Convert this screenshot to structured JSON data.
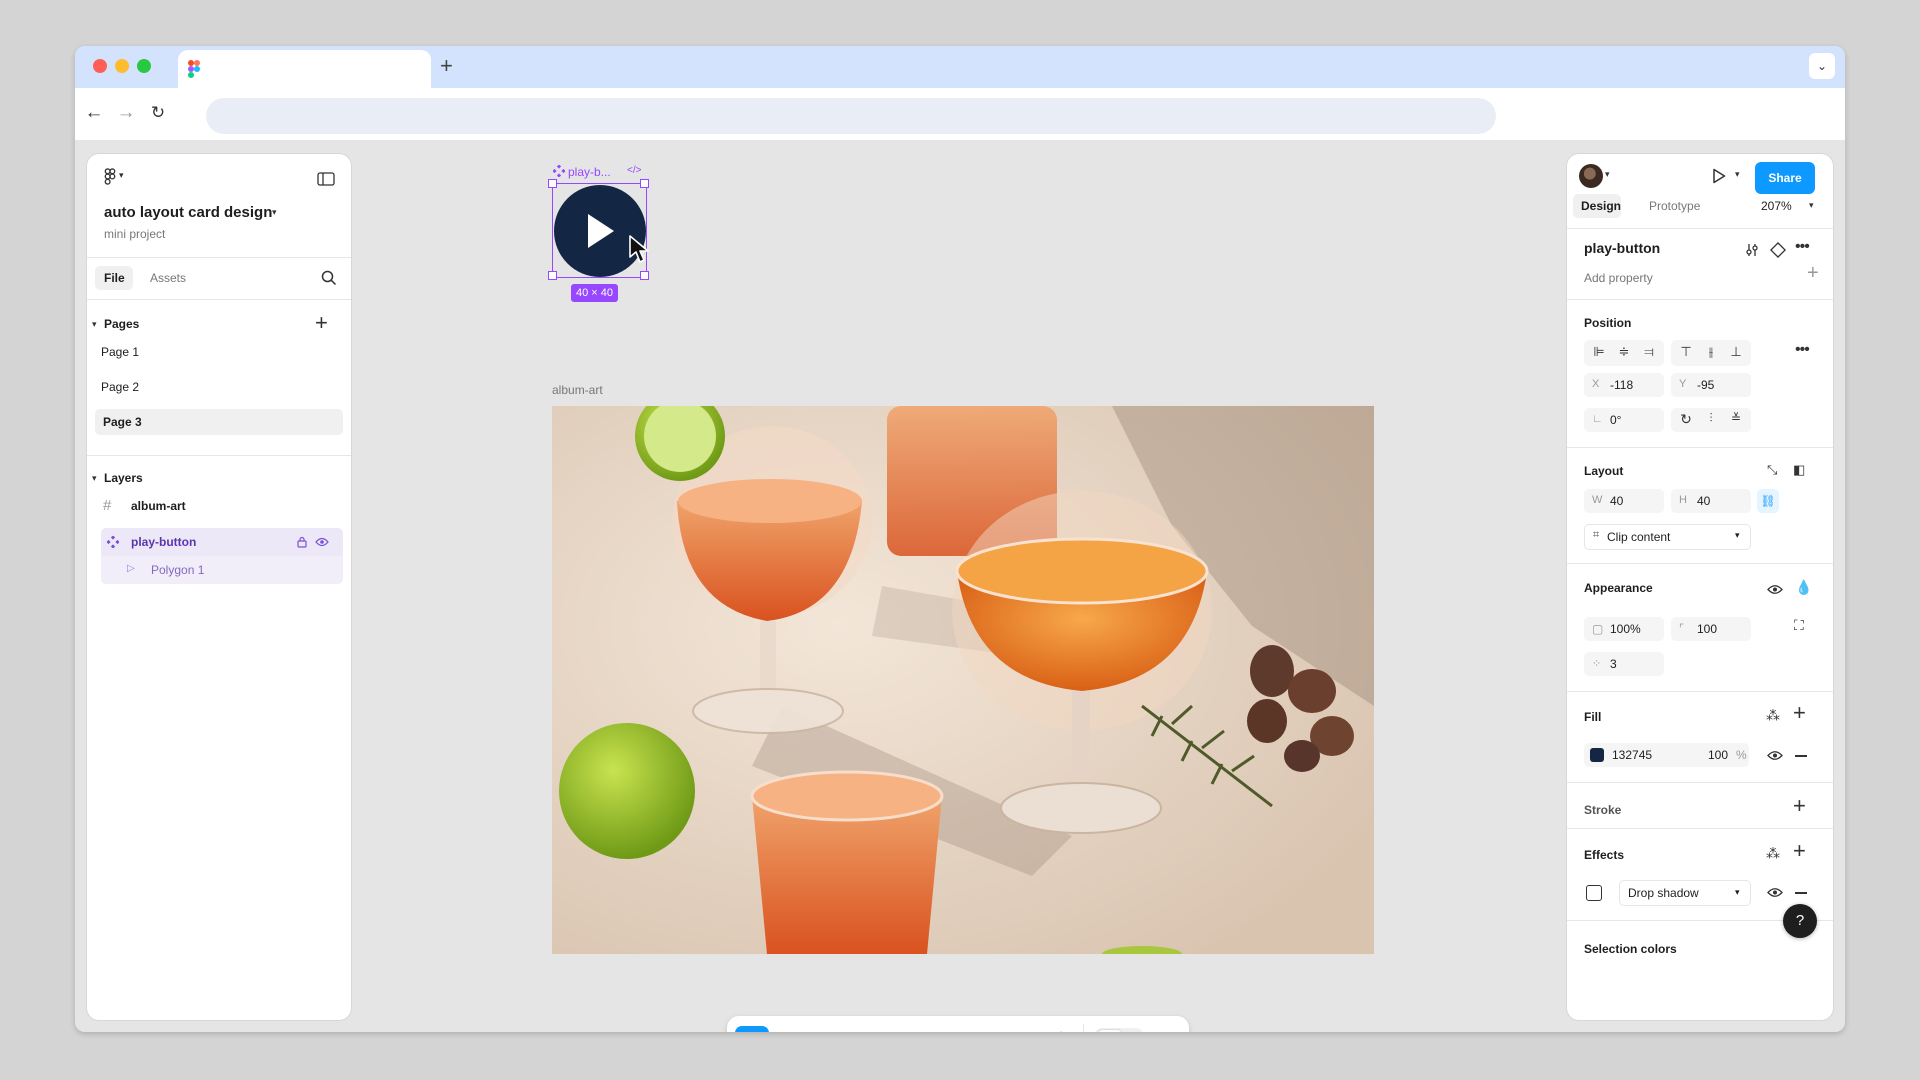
{
  "browser": {
    "new_tab_label": "+",
    "tab_menu_label": "⌄"
  },
  "file": {
    "title": "auto layout card design",
    "project": "mini project",
    "tabs": [
      "File",
      "Assets"
    ]
  },
  "pages": {
    "header": "Pages",
    "items": [
      "Page 1",
      "Page 2",
      "Page 3"
    ],
    "selected": "Page 3"
  },
  "layers": {
    "header": "Layers",
    "items": [
      {
        "name": "album-art",
        "icon": "frame-icon"
      },
      {
        "name": "play-button",
        "icon": "component-icon"
      },
      {
        "name": "Polygon 1",
        "icon": "polygon-icon"
      }
    ]
  },
  "canvas": {
    "component_label": "play-b...",
    "dimension_badge": "40 × 40",
    "frame_label": "album-art",
    "accent_color": "#9747ff",
    "button_color": "#132745"
  },
  "inspector": {
    "share_label": "Share",
    "tabs": [
      "Design",
      "Prototype"
    ],
    "zoom": "207%",
    "selection_name": "play-button",
    "add_property": "Add property",
    "position": {
      "header": "Position",
      "x_label": "X",
      "x": "-118",
      "y_label": "Y",
      "y": "-95",
      "rotation": "0°"
    },
    "layout": {
      "header": "Layout",
      "w_label": "W",
      "w": "40",
      "h_label": "H",
      "h": "40",
      "clip": "Clip content"
    },
    "appearance": {
      "header": "Appearance",
      "opacity": "100%",
      "radius": "100",
      "points": "3"
    },
    "fill": {
      "header": "Fill",
      "hex": "132745",
      "opacity": "100",
      "percent": "%",
      "swatch": "#132745"
    },
    "stroke": {
      "header": "Stroke"
    },
    "effects": {
      "header": "Effects",
      "type": "Drop shadow"
    },
    "selection_colors": "Selection colors",
    "help": "?"
  }
}
